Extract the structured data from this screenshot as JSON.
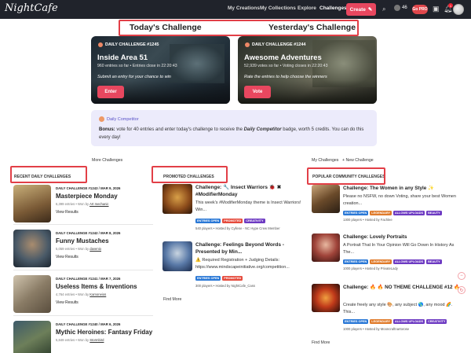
{
  "header": {
    "logo": "NightCafe",
    "nav": [
      "My Creations",
      "My Collections",
      "Explore",
      "Challenges"
    ],
    "create_label": "Create",
    "credits": "46",
    "pro_label": "Go PRO",
    "notif_count": "1"
  },
  "tabs": {
    "today": "Today's Challenge",
    "yesterday": "Yesterday's Challenge"
  },
  "today": {
    "label": "DAILY CHALLENGE #1245",
    "title": "Inside Area 51",
    "meta": "960 entries so far  •  Entries close in 22:20:43",
    "desc": "Submit an entry for your chance to win",
    "button": "Enter"
  },
  "yesterday": {
    "label": "DAILY CHALLENGE #1244",
    "title": "Awesome Adventures",
    "meta": "52,939 votes so far  •  Voting closes in 22:20:43",
    "desc": "Rate the entries to help choose the winners",
    "button": "Vote"
  },
  "competitor": {
    "pill": "Daily Competitor",
    "bonus_label": "Bonus:",
    "text_before": " vote for 40 entries and enter today's challenge to receive the ",
    "badge": "Daily Competitor",
    "text_after": " badge, worth 5 credits. You can do this every day!"
  },
  "links": {
    "more_challenges": "More Challenges",
    "my_challenges": "My Challenges",
    "new_challenge": "+ New Challenge",
    "find_more_promo": "Find More",
    "find_more_comm": "Find More"
  },
  "sections": {
    "recent": "RECENT DAILY CHALLENGES",
    "promoted": "PROMOTED CHALLENGES",
    "community": "POPULAR COMMUNITY CHALLENGES"
  },
  "recent": [
    {
      "kicker": "DAILY CHALLENGE #1243 / MAR 9, 2026",
      "name": "Masterpiece Monday",
      "entries": "6,399 entries  •  Won by ",
      "winner": "Art mechanic",
      "results": "View Results"
    },
    {
      "kicker": "DAILY CHALLENGE #1242 / MAR 8, 2026",
      "name": "Funny Mustaches",
      "entries": "5,059 entries  •  Won by ",
      "winner": "davenio",
      "results": "View Results"
    },
    {
      "kicker": "DAILY CHALLENGE #1241 / MAR 7, 2026",
      "name": "Useless Items & Inventions",
      "entries": "4,764 entries  •  Won by ",
      "winner": "Kamoneios",
      "results": "View Results"
    },
    {
      "kicker": "DAILY CHALLENGE #1240 / MAR 6, 2026",
      "name": "Mythic Heroines: Fantasy Friday ×...",
      "entries": "5,849 entries  •  Won by ",
      "winner": "Stormbird",
      "results": ""
    }
  ],
  "promoted": [
    {
      "title": "Challenge: 🔧 Insect Warriors 🐞 ✖ #ModifierMonday",
      "body": "This week's #ModifierMonday theme is Insect Warriors! Win...",
      "tags": [
        "ENTRIES OPEN",
        "PROMOTED",
        "CREATIVITY"
      ],
      "foot": "540 players  •  Hosted by Cyllene - NC Hype Crew Member"
    },
    {
      "title": "Challenge: Feelings Beyond Words - Presented by Min...",
      "body": "⚠️ Required Registration + Judging Details: https://www.mindscapeinitiative.org/competition...",
      "tags": [
        "ENTRIES OPEN",
        "PROMOTED"
      ],
      "foot": "300 players  •  Hosted by NightCafe_Cass"
    }
  ],
  "community": [
    {
      "title": "Challenge: The Women in any Style ✨",
      "body": "Please no NSFW, no down Voting, share your best Women creation...",
      "tags": [
        "ENTRIES OPEN",
        "LEGENDARY",
        "ALLOWS UPLOADS",
        "BEAUTY"
      ],
      "foot": "1300 players  •  Hosted by Fachlee"
    },
    {
      "title": "Challenge: Lovely Portraits",
      "body": "A Portrait That In Your Opinion Will Go Down In History As The...",
      "tags": [
        "ENTRIES OPEN",
        "LEGENDARY",
        "ALLOWS UPLOADS",
        "BEAUTY"
      ],
      "foot": "1000 players  •  Hosted by PrivateLady"
    },
    {
      "title": "Challenge: 🔥 🔥 NO THEME CHALLENGE #12 🔥",
      "body": "Create freely any style 🎨, any subject 🌎, any mood 🌈. This...",
      "tags": [
        "ENTRIES OPEN",
        "LEGENDARY",
        "ALLOWS UPLOADS",
        "CREATIVITY"
      ],
      "foot": "1000 players  •  Hosted by Mooncraftnartorose"
    }
  ]
}
